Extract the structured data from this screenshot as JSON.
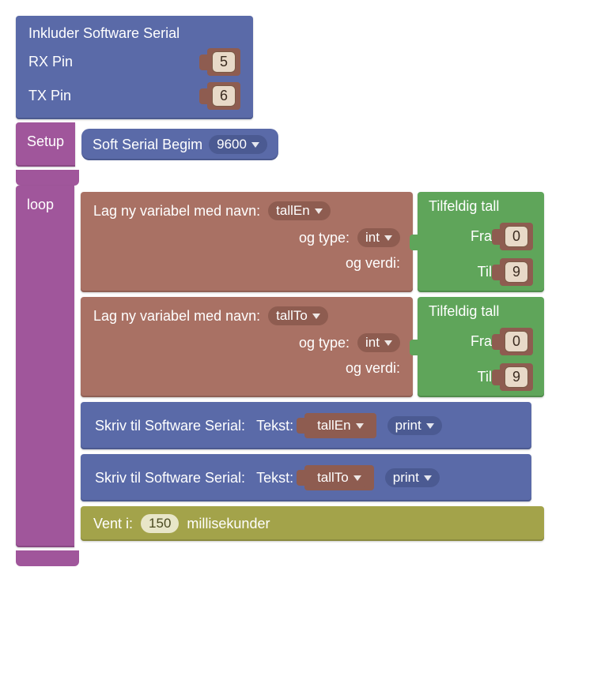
{
  "header": {
    "title": "Inkluder Software Serial",
    "rx_label": "RX Pin",
    "rx_value": "5",
    "tx_label": "TX Pin",
    "tx_value": "6"
  },
  "setup": {
    "label": "Setup",
    "begin_label": "Soft Serial Begim",
    "baud": "9600"
  },
  "loop": {
    "label": "loop",
    "vars": [
      {
        "make_label": "Lag ny variabel med navn:",
        "name": "tallEn",
        "type_label": "og type:",
        "type": "int",
        "value_label": "og verdi:",
        "random": {
          "title": "Tilfeldig tall",
          "from_label": "Fra",
          "from": "0",
          "to_label": "Til",
          "to": "9"
        }
      },
      {
        "make_label": "Lag ny variabel med navn:",
        "name": "tallTo",
        "type_label": "og type:",
        "type": "int",
        "value_label": "og verdi:",
        "random": {
          "title": "Tilfeldig tall",
          "from_label": "Fra",
          "from": "0",
          "to_label": "Til",
          "to": "9"
        }
      }
    ],
    "writes": [
      {
        "label": "Skriv til Software Serial:",
        "text_label": "Tekst:",
        "var": "tallEn",
        "mode": "print"
      },
      {
        "label": "Skriv til Software Serial:",
        "text_label": "Tekst:",
        "var": "tallTo",
        "mode": "print"
      }
    ],
    "wait": {
      "prefix": "Vent i:",
      "ms": "150",
      "suffix": "millisekunder"
    }
  }
}
